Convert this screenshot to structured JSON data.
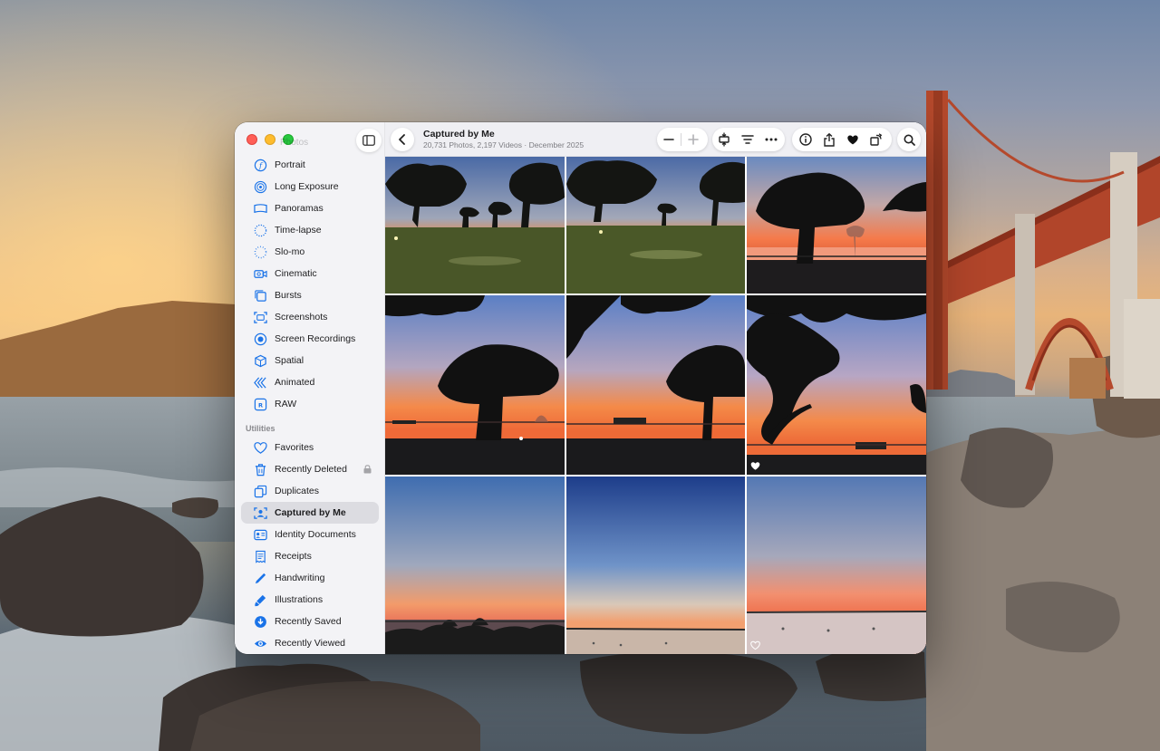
{
  "window": {
    "ghost_title": "Photos",
    "title": "Captured by Me",
    "subtitle": "20,731 Photos, 2,197 Videos · December 2025"
  },
  "sidebar": {
    "items_top": [
      {
        "label": "Portrait",
        "icon": "portrait-icon"
      },
      {
        "label": "Long Exposure",
        "icon": "long-exposure-icon"
      },
      {
        "label": "Panoramas",
        "icon": "panorama-icon"
      },
      {
        "label": "Time-lapse",
        "icon": "timelapse-icon"
      },
      {
        "label": "Slo-mo",
        "icon": "slomo-icon"
      },
      {
        "label": "Cinematic",
        "icon": "cinematic-icon"
      },
      {
        "label": "Bursts",
        "icon": "bursts-icon"
      },
      {
        "label": "Screenshots",
        "icon": "screenshot-icon"
      },
      {
        "label": "Screen Recordings",
        "icon": "screen-recording-icon"
      },
      {
        "label": "Spatial",
        "icon": "spatial-icon"
      },
      {
        "label": "Animated",
        "icon": "animated-icon"
      },
      {
        "label": "RAW",
        "icon": "raw-icon"
      }
    ],
    "section_label": "Utilities",
    "items_utilities": [
      {
        "label": "Favorites",
        "icon": "heart-icon"
      },
      {
        "label": "Recently Deleted",
        "icon": "trash-icon",
        "locked": true
      },
      {
        "label": "Duplicates",
        "icon": "duplicates-icon"
      },
      {
        "label": "Captured by Me",
        "icon": "captured-icon",
        "selected": true
      },
      {
        "label": "Identity Documents",
        "icon": "id-card-icon"
      },
      {
        "label": "Receipts",
        "icon": "receipt-icon"
      },
      {
        "label": "Handwriting",
        "icon": "pen-icon"
      },
      {
        "label": "Illustrations",
        "icon": "illustrations-icon"
      },
      {
        "label": "Recently Saved",
        "icon": "recently-saved-icon"
      },
      {
        "label": "Recently Viewed",
        "icon": "eye-icon"
      }
    ]
  },
  "toolbar": {
    "icons": [
      "back-icon",
      "zoom-out-icon",
      "zoom-in-icon",
      "aspect-icon",
      "filter-icon",
      "more-icon",
      "info-icon",
      "share-icon",
      "favorite-icon",
      "rotate-icon",
      "search-icon"
    ]
  },
  "photos": [
    {
      "scene": "sunset-trees-lawn",
      "favorite": false
    },
    {
      "scene": "sunset-trees-lawn",
      "favorite": false
    },
    {
      "scene": "sunset-tree-water",
      "favorite": false
    },
    {
      "scene": "sunset-oak-pier",
      "favorite": false
    },
    {
      "scene": "sunset-oak-pier",
      "favorite": false
    },
    {
      "scene": "sunset-branches",
      "favorite": true
    },
    {
      "scene": "dusk-shoreline",
      "favorite": false
    },
    {
      "scene": "dusk-sky",
      "favorite": false
    },
    {
      "scene": "dusk-beach",
      "favorite": "outline"
    }
  ],
  "colors": {
    "accent": "#1a73e8",
    "selected_row": "#dcdce1",
    "sidebar_bg": "#f3f3f6"
  }
}
